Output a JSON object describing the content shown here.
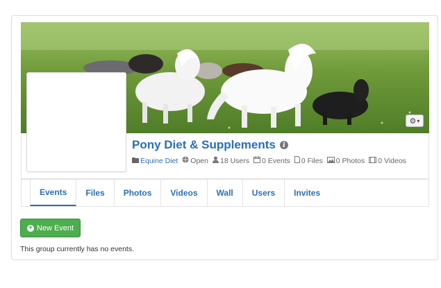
{
  "group": {
    "name": "Pony Diet & Supplements",
    "category": "Equine Diet",
    "privacy": "Open",
    "users": "18 Users",
    "events": "0 Events",
    "files": "0 Files",
    "photos": "0 Photos",
    "videos": "0 Videos"
  },
  "icons": {
    "category": "folder-icon",
    "privacy": "globe-icon",
    "users": "user-icon",
    "events": "calendar-icon",
    "files": "file-icon",
    "photos": "picture-icon",
    "videos": "film-icon",
    "settings": "gear-icon",
    "info": "info-icon",
    "new_event": "plus-circle-icon"
  },
  "tabs": [
    "Events",
    "Files",
    "Photos",
    "Videos",
    "Wall",
    "Users",
    "Invites"
  ],
  "active_tab": "Events",
  "actions": {
    "new_event": "New Event"
  },
  "empty_message": "This group currently has no events.",
  "colors": {
    "link": "#2a6fb3",
    "success": "#4cae4c"
  }
}
